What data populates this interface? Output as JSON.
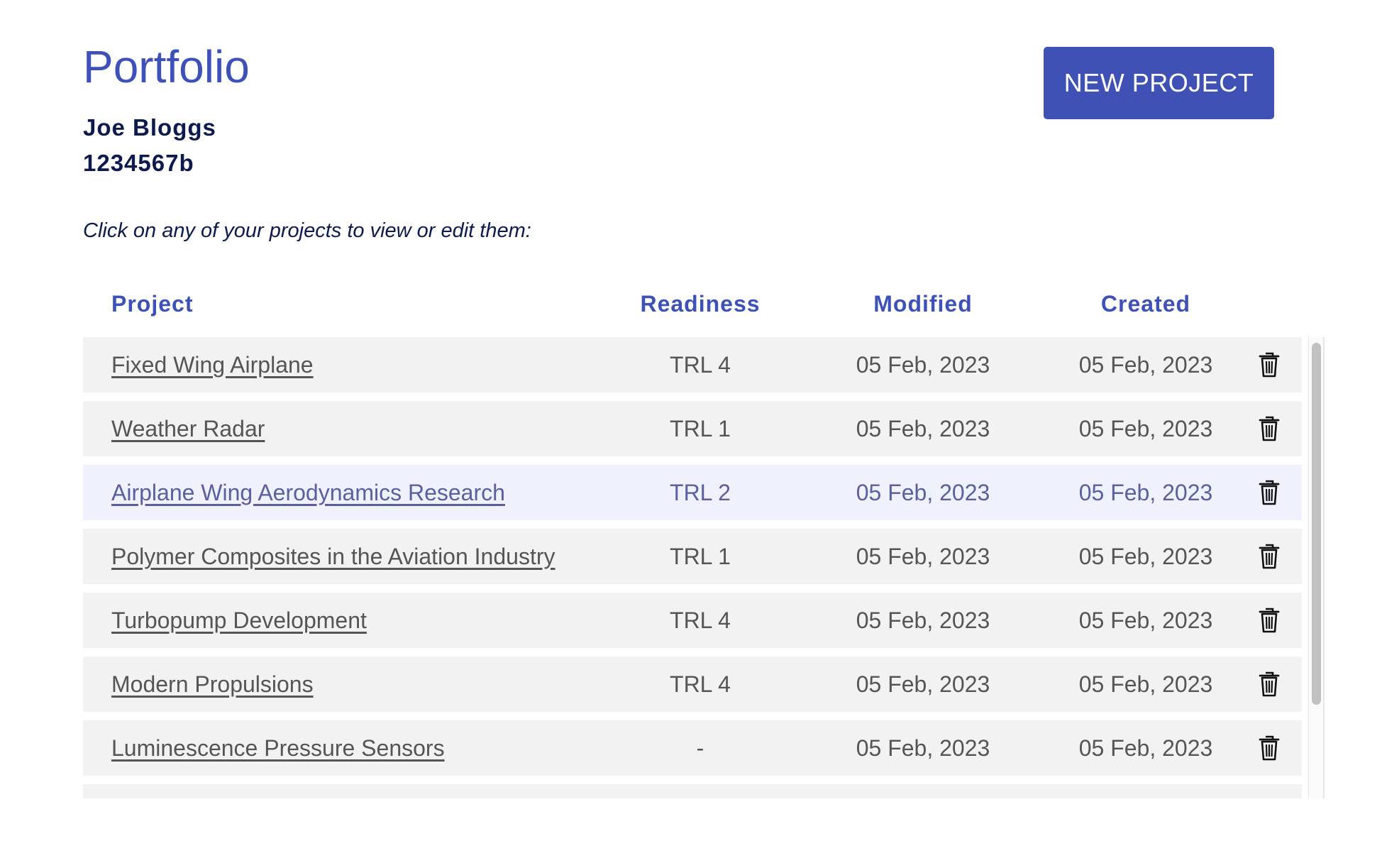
{
  "header": {
    "title": "Portfolio",
    "user_name": "Joe Bloggs",
    "user_id": "1234567b",
    "new_project_label": "NEW PROJECT"
  },
  "instruction": "Click on any of your projects to view or edit them:",
  "table": {
    "columns": {
      "project": "Project",
      "readiness": "Readiness",
      "modified": "Modified",
      "created": "Created"
    },
    "rows": [
      {
        "project": "Fixed Wing Airplane",
        "readiness": "TRL 4",
        "modified": "05 Feb, 2023",
        "created": "05 Feb, 2023"
      },
      {
        "project": "Weather Radar",
        "readiness": "TRL 1",
        "modified": "05 Feb, 2023",
        "created": "05 Feb, 2023"
      },
      {
        "project": "Airplane Wing Aerodynamics Research",
        "readiness": "TRL 2",
        "modified": "05 Feb, 2023",
        "created": "05 Feb, 2023"
      },
      {
        "project": "Polymer Composites in the Aviation Industry",
        "readiness": "TRL 1",
        "modified": "05 Feb, 2023",
        "created": "05 Feb, 2023"
      },
      {
        "project": "Turbopump Development",
        "readiness": "TRL 4",
        "modified": "05 Feb, 2023",
        "created": "05 Feb, 2023"
      },
      {
        "project": "Modern Propulsions",
        "readiness": "TRL 4",
        "modified": "05 Feb, 2023",
        "created": "05 Feb, 2023"
      },
      {
        "project": "Luminescence Pressure Sensors",
        "readiness": "-",
        "modified": "05 Feb, 2023",
        "created": "05 Feb, 2023"
      }
    ],
    "hovered_row": 2,
    "row_action_icon": "trash-icon"
  },
  "colors": {
    "accent": "#3f51b5",
    "heading": "#3d51b8",
    "user_text": "#0d1a4d",
    "row_bg": "#f2f2f2",
    "row_hover_bg": "#eff2fc"
  }
}
